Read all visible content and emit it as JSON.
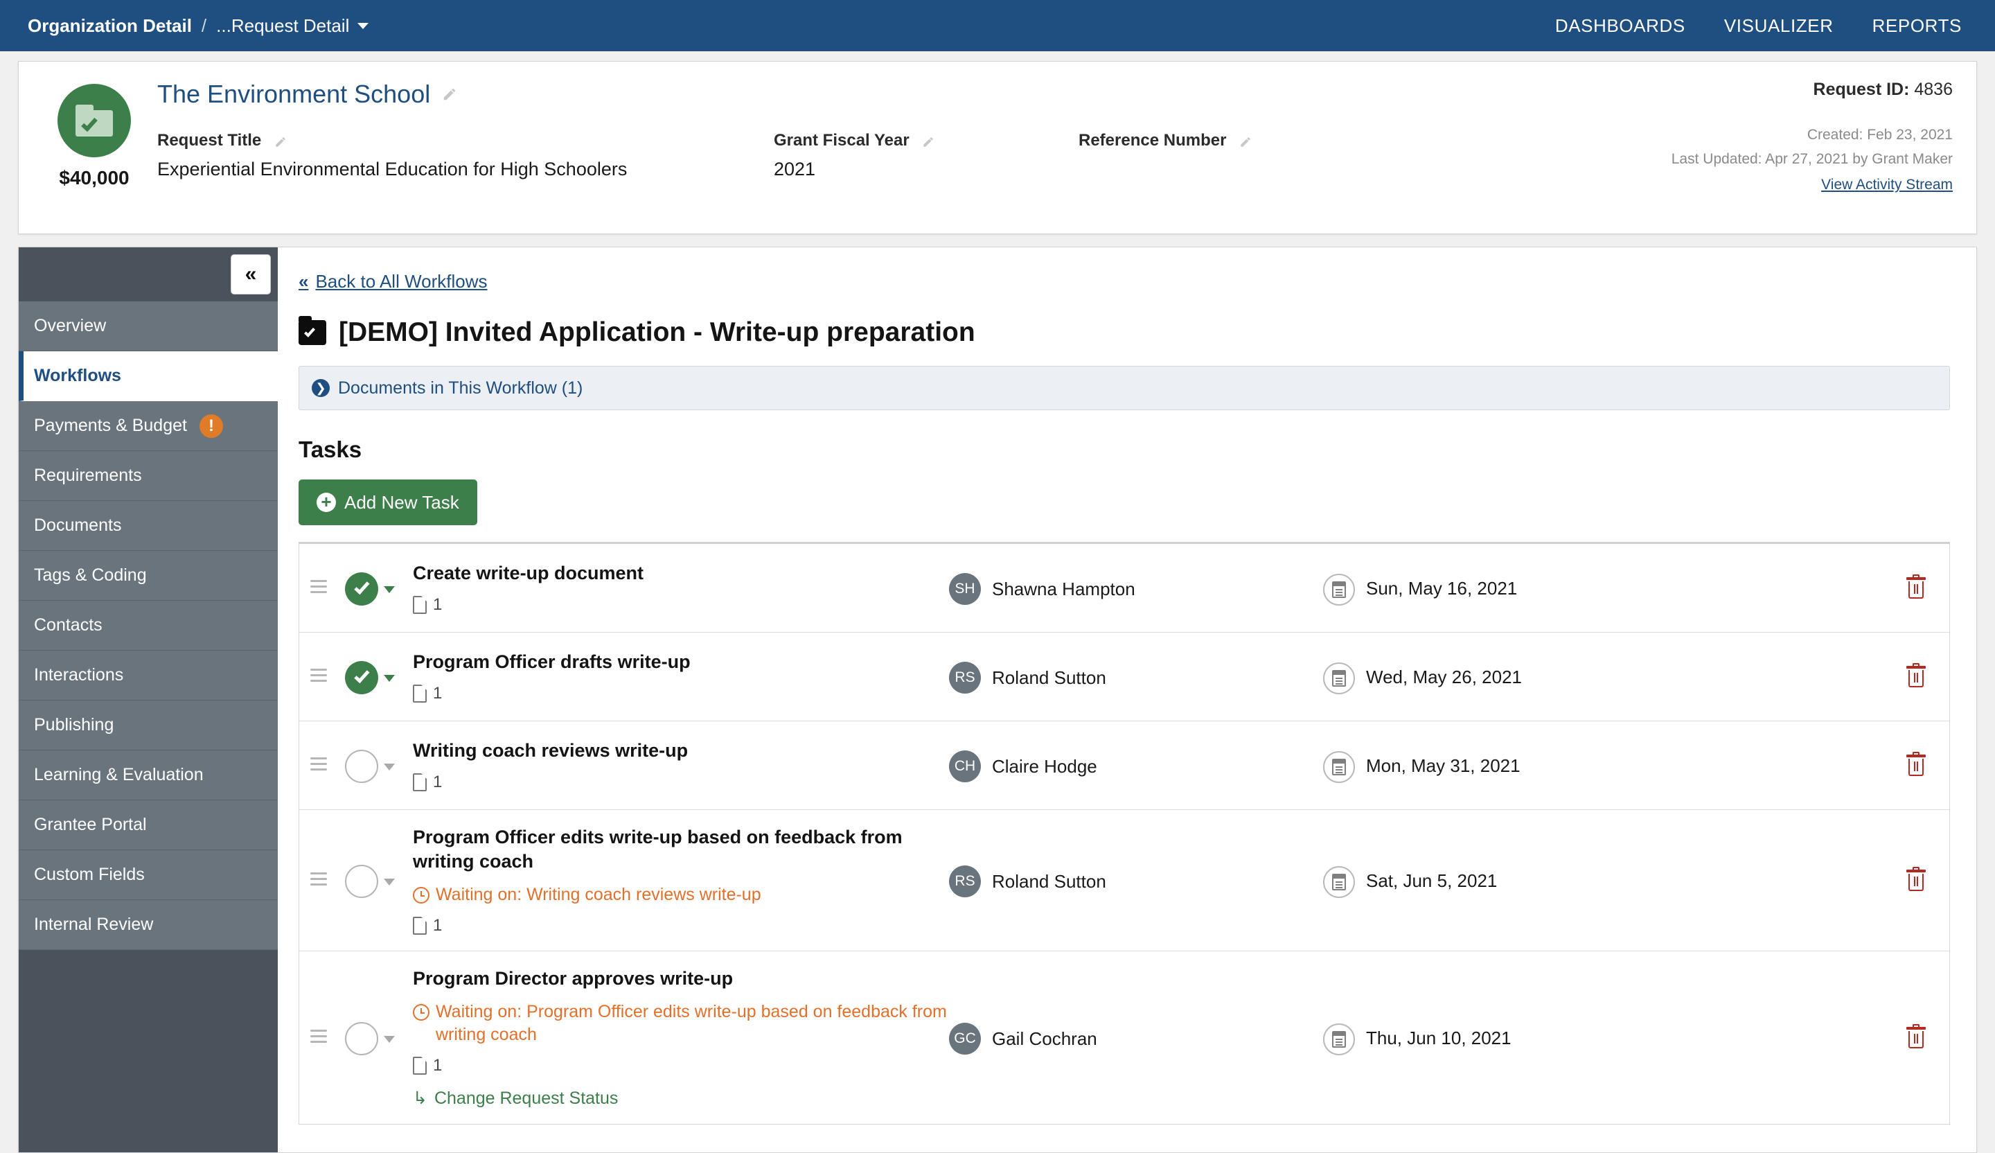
{
  "topnav": {
    "breadcrumb_org": "Organization Detail",
    "breadcrumb_sep": "/",
    "breadcrumb_request": "...Request Detail",
    "links": [
      {
        "label": "DASHBOARDS"
      },
      {
        "label": "VISUALIZER"
      },
      {
        "label": "REPORTS"
      }
    ]
  },
  "record": {
    "amount": "$40,000",
    "org_name": "The Environment School",
    "fields": [
      {
        "label": "Request Title",
        "value": "Experiential Environmental Education for High Schoolers"
      },
      {
        "label": "Grant Fiscal Year",
        "value": "2021"
      },
      {
        "label": "Reference Number",
        "value": ""
      }
    ],
    "request_id_label": "Request ID:",
    "request_id_value": "4836",
    "created": "Created: Feb 23, 2021",
    "last_updated": "Last Updated: Apr 27, 2021 by Grant Maker",
    "activity_link": "View Activity Stream"
  },
  "sidebar": {
    "collapse_label": "«",
    "items": [
      {
        "label": "Overview",
        "active": false,
        "badge": ""
      },
      {
        "label": "Workflows",
        "active": true,
        "badge": ""
      },
      {
        "label": "Payments & Budget",
        "active": false,
        "badge": "!"
      },
      {
        "label": "Requirements",
        "active": false,
        "badge": ""
      },
      {
        "label": "Documents",
        "active": false,
        "badge": ""
      },
      {
        "label": "Tags & Coding",
        "active": false,
        "badge": ""
      },
      {
        "label": "Contacts",
        "active": false,
        "badge": ""
      },
      {
        "label": "Interactions",
        "active": false,
        "badge": ""
      },
      {
        "label": "Publishing",
        "active": false,
        "badge": ""
      },
      {
        "label": "Learning & Evaluation",
        "active": false,
        "badge": ""
      },
      {
        "label": "Grantee Portal",
        "active": false,
        "badge": ""
      },
      {
        "label": "Custom Fields",
        "active": false,
        "badge": ""
      },
      {
        "label": "Internal Review",
        "active": false,
        "badge": ""
      }
    ]
  },
  "main": {
    "back_link": "Back to All Workflows",
    "back_chevron": "«",
    "workflow_title": "[DEMO] Invited Application - Write-up preparation",
    "documents_bar": "Documents in This Workflow (1)",
    "documents_bar_arrow": "❯",
    "tasks_heading": "Tasks",
    "add_task_label": "Add New Task",
    "add_task_plus": "+",
    "tasks": [
      {
        "title": "Create write-up document",
        "status": "done",
        "waiting_on": "",
        "doc_count": "1",
        "change_status_link": "",
        "assignee_initials": "SH",
        "assignee_name": "Shawna Hampton",
        "due_date": "Sun, May 16, 2021"
      },
      {
        "title": "Program Officer drafts write-up",
        "status": "done",
        "waiting_on": "",
        "doc_count": "1",
        "change_status_link": "",
        "assignee_initials": "RS",
        "assignee_name": "Roland Sutton",
        "due_date": "Wed, May 26, 2021"
      },
      {
        "title": "Writing coach reviews write-up",
        "status": "open",
        "waiting_on": "",
        "doc_count": "1",
        "change_status_link": "",
        "assignee_initials": "CH",
        "assignee_name": "Claire Hodge",
        "due_date": "Mon, May 31, 2021"
      },
      {
        "title": "Program Officer edits write-up based on feedback from writing coach",
        "status": "open",
        "waiting_on": "Waiting on: Writing coach reviews write-up",
        "doc_count": "1",
        "change_status_link": "",
        "assignee_initials": "RS",
        "assignee_name": "Roland Sutton",
        "due_date": "Sat, Jun 5, 2021"
      },
      {
        "title": "Program Director approves write-up",
        "status": "open",
        "waiting_on": "Waiting on: Program Officer edits write-up based on feedback from writing coach",
        "doc_count": "1",
        "change_status_link": "Change Request Status",
        "change_status_arrow": "↳",
        "assignee_initials": "GC",
        "assignee_name": "Gail Cochran",
        "due_date": "Thu, Jun 10, 2021"
      }
    ]
  },
  "colors": {
    "nav_blue": "#1f4e80",
    "green": "#3d7f4a",
    "sidebar_grey": "#6a747d",
    "sidebar_dark": "#4a535c",
    "orange": "#e3702a",
    "badge_orange": "#e07b28",
    "trash_red": "#b22a22"
  }
}
